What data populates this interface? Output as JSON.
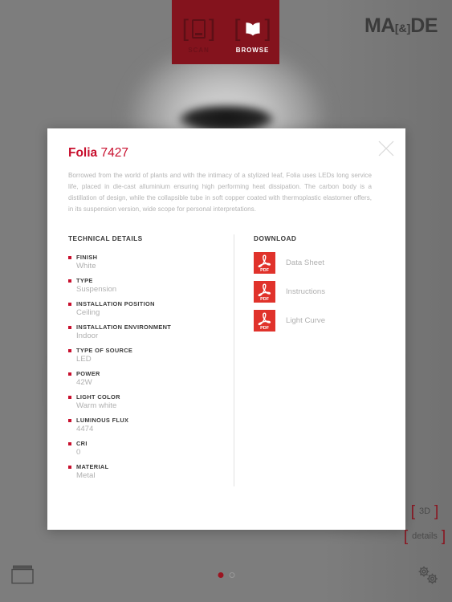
{
  "topbar": {
    "modes": [
      {
        "label": "SCAN",
        "icon": "scan-icon",
        "active": false
      },
      {
        "label": "BROWSE",
        "icon": "book-icon",
        "active": true
      }
    ],
    "background_color": "#84131d"
  },
  "logo": {
    "part1": "MA",
    "amp": "[&]",
    "part2": "DE"
  },
  "modal": {
    "title_name": "Folia",
    "title_code": "7427",
    "accent_color": "#c8102e",
    "close_label": "×",
    "description": "Borrowed from the world of plants and with the intimacy of a stylized leaf, Folia uses LEDs long service life, placed in die-cast alluminium ensuring high performing heat dissipation. The carbon body is a distillation of design, while the collapsible tube in soft copper coated with thermoplastic elastomer offers, in its suspension version, wide scope for personal interpretations.",
    "technical": {
      "heading": "TECHNICAL DETAILS",
      "specs": [
        {
          "key": "FINISH",
          "value": "White"
        },
        {
          "key": "TYPE",
          "value": "Suspension"
        },
        {
          "key": "INSTALLATION POSITION",
          "value": "Ceiling"
        },
        {
          "key": "INSTALLATION ENVIRONMENT",
          "value": "Indoor"
        },
        {
          "key": "TYPE OF SOURCE",
          "value": "LED"
        },
        {
          "key": "POWER",
          "value": "42W"
        },
        {
          "key": "LIGHT COLOR",
          "value": "Warm white"
        },
        {
          "key": "LUMINOUS FLUX",
          "value": "4474"
        },
        {
          "key": "CRI",
          "value": "0"
        },
        {
          "key": "MATERIAL",
          "value": "Metal"
        }
      ]
    },
    "download": {
      "heading": "DOWNLOAD",
      "items": [
        {
          "label": "Data Sheet",
          "icon": "pdf-icon"
        },
        {
          "label": "Instructions",
          "icon": "pdf-icon"
        },
        {
          "label": "Light Curve",
          "icon": "pdf-icon"
        }
      ],
      "icon_color": "#e0322b"
    }
  },
  "side_actions": [
    {
      "label": "3D",
      "bracket_left": "[",
      "bracket_right": "]"
    },
    {
      "label": "details",
      "bracket_left": "[",
      "bracket_right": "]"
    }
  ],
  "bottombar": {
    "archive_icon": "archive-box-icon",
    "settings_icon": "gears-icon",
    "pager": {
      "total": 2,
      "current": 1,
      "active_color": "#9b1420"
    }
  }
}
